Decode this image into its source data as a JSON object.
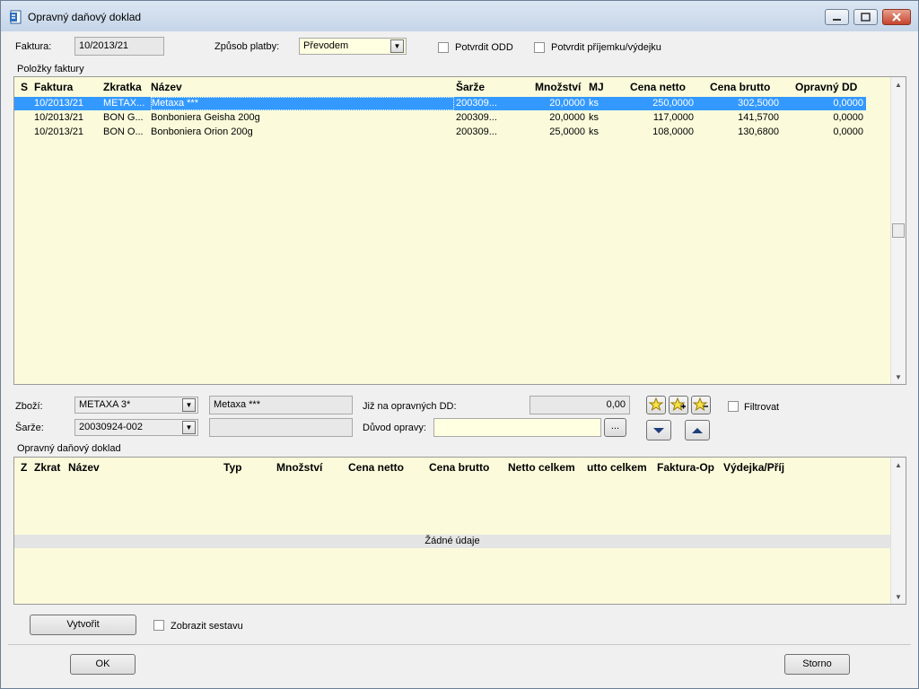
{
  "window": {
    "title": "Opravný daňový doklad",
    "icon": "document-icon"
  },
  "header": {
    "faktura_label": "Faktura:",
    "faktura_value": "10/2013/21",
    "zpusob_label": "Způsob platby:",
    "zpusob_value": "Převodem",
    "potvrdit_odd": "Potvrdit ODD",
    "potvrdit_prijemku": "Potvrdit příjemku/výdejku"
  },
  "polozky": {
    "group_label": "Položky faktury",
    "columns": [
      "S",
      "Faktura",
      "Zkratka",
      "Název",
      "Šarže",
      "Množství",
      "MJ",
      "Cena netto",
      "Cena brutto",
      "Opravný DD"
    ],
    "rows": [
      [
        "",
        "10/2013/21",
        "METAX...",
        "Metaxa ***",
        "200309...",
        "20,0000",
        "ks",
        "250,0000",
        "302,5000",
        "0,0000"
      ],
      [
        "",
        "10/2013/21",
        "BON G...",
        "Bonboniera Geisha 200g",
        "200309...",
        "20,0000",
        "ks",
        "117,0000",
        "141,5700",
        "0,0000"
      ],
      [
        "",
        "10/2013/21",
        "BON O...",
        "Bonboniera Orion 200g",
        "200309...",
        "25,0000",
        "ks",
        "108,0000",
        "130,6800",
        "0,0000"
      ]
    ]
  },
  "detail": {
    "zbozi_label": "Zboží:",
    "zbozi_value": "METAXA 3*",
    "zbozi_name": "Metaxa ***",
    "jiz_label": "Již na opravných DD:",
    "jiz_value": "0,00",
    "sarze_label": "Šarže:",
    "sarze_value": "20030924-002",
    "sarze_extra": "",
    "duvod_label": "Důvod opravy:",
    "duvod_value": "",
    "ellipsis": "...",
    "filtrovat": "Filtrovat"
  },
  "opravny": {
    "group_label": "Opravný daňový doklad",
    "columns": [
      "Z",
      "Zkrat",
      "Název",
      "Typ",
      "Množství",
      "Cena netto",
      "Cena brutto",
      "Netto celkem",
      "utto celkem",
      "Faktura-Op",
      "Výdejka/Příj"
    ],
    "empty_text": "Žádné údaje"
  },
  "footer": {
    "vytvorit": "Vytvořit",
    "zobrazit": "Zobrazit sestavu",
    "ok": "OK",
    "storno": "Storno"
  },
  "colors": {
    "grid_bg": "#fbfbdc",
    "selection": "#3399ff",
    "title_bg": "#dbe6f3"
  }
}
